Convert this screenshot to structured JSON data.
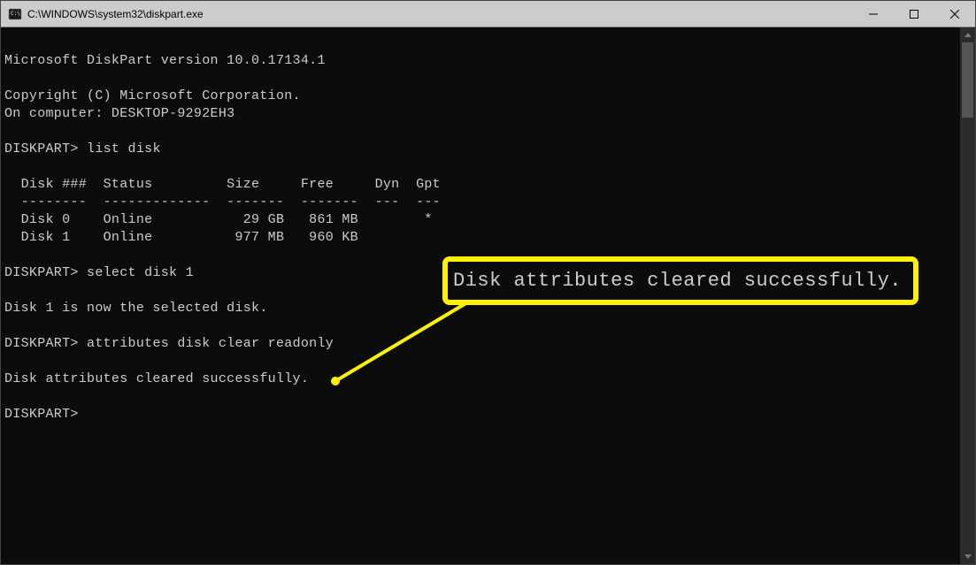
{
  "window": {
    "title": "C:\\WINDOWS\\system32\\diskpart.exe"
  },
  "terminal": {
    "header_version": "Microsoft DiskPart version 10.0.17134.1",
    "copyright": "Copyright (C) Microsoft Corporation.",
    "computer_line": "On computer: DESKTOP-9292EH3",
    "prompt": "DISKPART>",
    "cmd_list": "list disk",
    "table_header": "  Disk ###  Status         Size     Free     Dyn  Gpt",
    "table_sep": "  --------  -------------  -------  -------  ---  ---",
    "row_disk0": "  Disk 0    Online           29 GB   861 MB        *",
    "row_disk1": "  Disk 1    Online          977 MB   960 KB",
    "cmd_select": "select disk 1",
    "resp_select": "Disk 1 is now the selected disk.",
    "cmd_attrib": "attributes disk clear readonly",
    "resp_attrib": "Disk attributes cleared successfully."
  },
  "callout": {
    "text": "Disk attributes cleared successfully."
  }
}
